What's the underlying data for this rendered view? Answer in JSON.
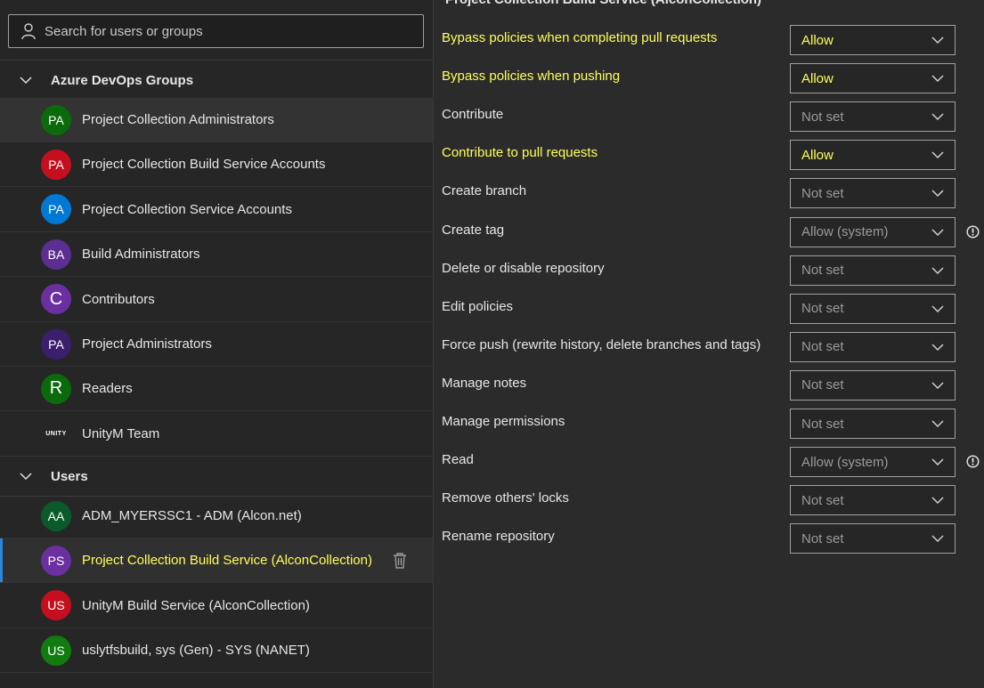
{
  "search": {
    "placeholder": "Search for users or groups"
  },
  "groups_header": "Azure DevOps Groups",
  "groups": [
    {
      "initials": "PA",
      "name": "Project Collection Administrators",
      "color": "#0b6a0b"
    },
    {
      "initials": "PA",
      "name": "Project Collection Build Service Accounts",
      "color": "#c50f1f"
    },
    {
      "initials": "PA",
      "name": "Project Collection Service Accounts",
      "color": "#0078d4"
    },
    {
      "initials": "BA",
      "name": "Build Administrators",
      "color": "#5c2e91"
    },
    {
      "initials": "C",
      "name": "Contributors",
      "color": "#6b2fa0"
    },
    {
      "initials": "PA",
      "name": "Project Administrators",
      "color": "#3b1f6e"
    },
    {
      "initials": "R",
      "name": "Readers",
      "color": "#0b6a0b"
    },
    {
      "initials": "UNITY",
      "name": "UnityM Team",
      "color": "#262626"
    }
  ],
  "users_header": "Users",
  "users": [
    {
      "initials": "AA",
      "name": "ADM_MYERSSC1 - ADM (Alcon.net)",
      "color": "#0b5a2b"
    },
    {
      "initials": "PS",
      "name": "Project Collection Build Service (AlconCollection)",
      "color": "#6b2fa0"
    },
    {
      "initials": "US",
      "name": "UnityM Build Service (AlconCollection)",
      "color": "#c50f1f"
    },
    {
      "initials": "US",
      "name": "uslytfsbuild, sys (Gen) - SYS (NANET)",
      "color": "#107c10"
    }
  ],
  "right_title": "Project Collection Build Service (AlconCollection)",
  "permissions": [
    {
      "label": "Bypass policies when completing pull requests",
      "value": "Allow",
      "highlight": true
    },
    {
      "label": "Bypass policies when pushing",
      "value": "Allow",
      "highlight": true
    },
    {
      "label": "Contribute",
      "value": "Not set",
      "highlight": false
    },
    {
      "label": "Contribute to pull requests",
      "value": "Allow",
      "highlight": true
    },
    {
      "label": "Create branch",
      "value": "Not set",
      "highlight": false
    },
    {
      "label": "Create tag",
      "value": "Allow (system)",
      "highlight": false,
      "info": true
    },
    {
      "label": "Delete or disable repository",
      "value": "Not set",
      "highlight": false
    },
    {
      "label": "Edit policies",
      "value": "Not set",
      "highlight": false
    },
    {
      "label": "Force push (rewrite history, delete branches and tags)",
      "value": "Not set",
      "highlight": false
    },
    {
      "label": "Manage notes",
      "value": "Not set",
      "highlight": false
    },
    {
      "label": "Manage permissions",
      "value": "Not set",
      "highlight": false
    },
    {
      "label": "Read",
      "value": "Allow (system)",
      "highlight": false,
      "info": true
    },
    {
      "label": "Remove others' locks",
      "value": "Not set",
      "highlight": false
    },
    {
      "label": "Rename repository",
      "value": "Not set",
      "highlight": false
    }
  ],
  "colors": {
    "highlight": "#ffff5a",
    "accent": "#2b88d8"
  }
}
